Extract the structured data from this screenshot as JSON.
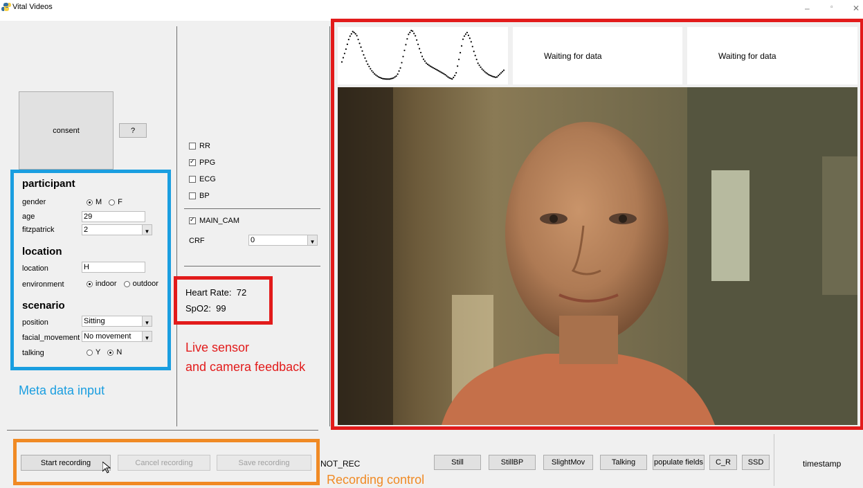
{
  "window": {
    "title": "Vital Videos"
  },
  "consent": {
    "label": "consent",
    "help_label": "?"
  },
  "participant": {
    "heading": "participant",
    "gender_label": "gender",
    "gender_m": "M",
    "gender_f": "F",
    "gender_selected": "M",
    "age_label": "age",
    "age_value": "29",
    "fitzpatrick_label": "fitzpatrick",
    "fitzpatrick_value": "2"
  },
  "location": {
    "heading": "location",
    "location_label": "location",
    "location_value": "H",
    "environment_label": "environment",
    "env_indoor": "indoor",
    "env_outdoor": "outdoor",
    "env_selected": "indoor"
  },
  "scenario": {
    "heading": "scenario",
    "position_label": "position",
    "position_value": "Sitting",
    "facial_label": "facial_movement",
    "facial_value": "No movement",
    "talking_label": "talking",
    "talking_y": "Y",
    "talking_n": "N",
    "talking_selected": "N"
  },
  "sensors": {
    "rr": "RR",
    "rr_checked": false,
    "ppg": "PPG",
    "ppg_checked": true,
    "ecg": "ECG",
    "ecg_checked": false,
    "bp": "BP",
    "bp_checked": false,
    "main_cam": "MAIN_CAM",
    "main_cam_checked": true,
    "crf_label": "CRF",
    "crf_value": "0"
  },
  "vitals": {
    "hr_label": "Heart Rate:",
    "hr_value": "72",
    "spo2_label": "SpO2:",
    "spo2_value": "99"
  },
  "feeds": {
    "waiting_1": "Waiting for data",
    "waiting_2": "Waiting for data"
  },
  "ppg_plot": {
    "samples": [
      0.62,
      0.4,
      0.15,
      0.03,
      0.1,
      0.3,
      0.5,
      0.66,
      0.78,
      0.86,
      0.91,
      0.94,
      0.95,
      0.95,
      0.93,
      0.88,
      0.72,
      0.4,
      0.1,
      0.0,
      0.12,
      0.35,
      0.55,
      0.65,
      0.7,
      0.74,
      0.78,
      0.82,
      0.86,
      0.92,
      0.95,
      0.85,
      0.5,
      0.15,
      0.05,
      0.2,
      0.45,
      0.65,
      0.75,
      0.82,
      0.87,
      0.9,
      0.92,
      0.85,
      0.78
    ]
  },
  "annotations": {
    "meta": "Meta data input",
    "live_1": "Live sensor",
    "live_2": "and camera feedback",
    "recording": "Recording control",
    "meta_color": "#1a9ee0",
    "live_color": "#e21b1b",
    "rec_color": "#f08a24"
  },
  "recording": {
    "start": "Start recording",
    "cancel": "Cancel recording",
    "save": "Save recording",
    "status": "NOT_REC",
    "still": "Still",
    "stillbp": "StillBP",
    "slightmov": "SlightMov",
    "talking": "Talking",
    "populate": "populate fields",
    "c_r": "C_R",
    "ssd": "SSD",
    "timestamp": "timestamp"
  }
}
